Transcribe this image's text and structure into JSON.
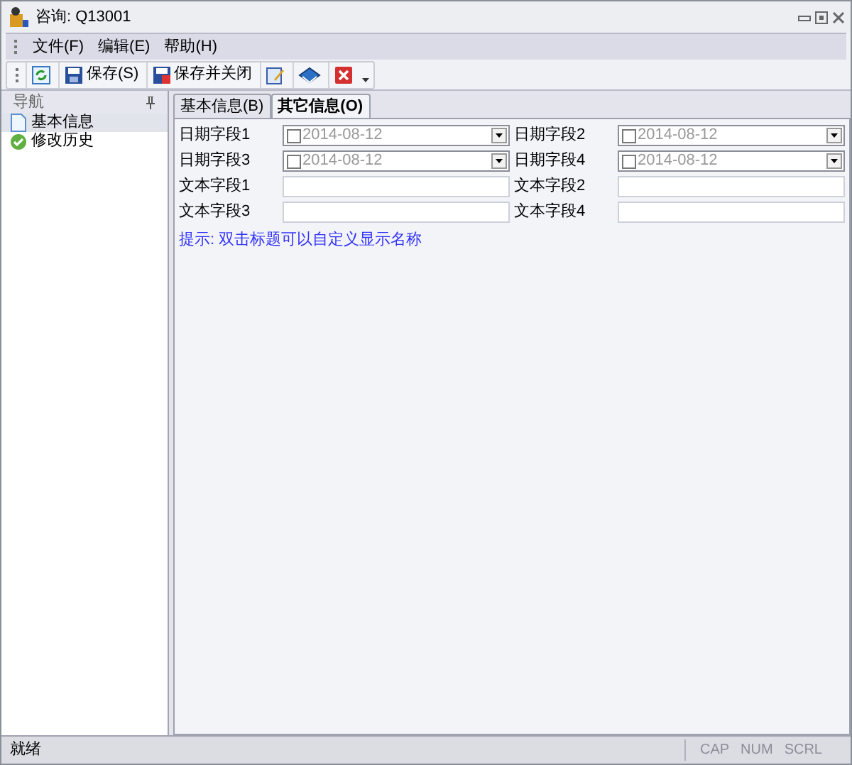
{
  "window": {
    "title": "咨询: Q13001"
  },
  "menu": [
    "文件(F)",
    "编辑(E)",
    "帮助(H)"
  ],
  "toolbar": [
    {
      "kind": "refresh"
    },
    {
      "kind": "save",
      "label": "保存(S)"
    },
    {
      "kind": "save-close",
      "label": "保存并关闭"
    },
    {
      "kind": "edit"
    },
    {
      "kind": "book"
    },
    {
      "kind": "delete"
    }
  ],
  "nav": {
    "title": "导航",
    "items": [
      {
        "label": "基本信息",
        "kind": "page",
        "selected": true
      },
      {
        "label": "修改历史",
        "kind": "history",
        "selected": false
      }
    ]
  },
  "tabs": [
    {
      "label": "基本信息(B)",
      "selected": false
    },
    {
      "label": "其它信息(O)",
      "selected": true
    }
  ],
  "fields": [
    {
      "label": "日期字段1",
      "kind": "date",
      "checked": false,
      "value": "2014-08-12"
    },
    {
      "label": "日期字段2",
      "kind": "date",
      "checked": false,
      "value": "2014-08-12"
    },
    {
      "label": "日期字段3",
      "kind": "date",
      "checked": false,
      "value": "2014-08-12"
    },
    {
      "label": "日期字段4",
      "kind": "date",
      "checked": false,
      "value": "2014-08-12"
    },
    {
      "label": "文本字段1",
      "kind": "text"
    },
    {
      "label": "文本字段2",
      "kind": "text"
    },
    {
      "label": "文本字段3",
      "kind": "text"
    },
    {
      "label": "文本字段4",
      "kind": "text"
    }
  ],
  "hint": "提示: 双击标题可以自定义显示名称",
  "status_bar": {
    "text": "就绪",
    "indicators": [
      "CAP",
      "NUM",
      "SCRL"
    ]
  }
}
